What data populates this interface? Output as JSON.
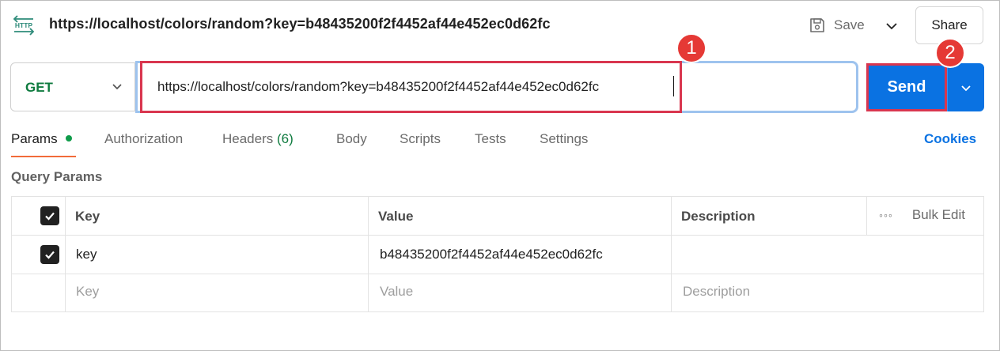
{
  "header": {
    "icon": "http-icon",
    "icon_text": "HTTP",
    "title": "https://localhost/colors/random?key=b48435200f2f4452af44e452ec0d62fc",
    "save_label": "Save",
    "share_label": "Share"
  },
  "request": {
    "method": "GET",
    "url": "https://localhost/colors/random?key=b48435200f2f4452af44e452ec0d62fc",
    "send_label": "Send"
  },
  "annotations": {
    "badge1": "1",
    "badge2": "2",
    "highlight_color": "#d9364f"
  },
  "tabs": [
    {
      "label": "Params",
      "active": true,
      "indicator": "green-dot"
    },
    {
      "label": "Authorization"
    },
    {
      "label": "Headers",
      "count": "(6)"
    },
    {
      "label": "Body"
    },
    {
      "label": "Scripts"
    },
    {
      "label": "Tests"
    },
    {
      "label": "Settings"
    }
  ],
  "cookies_label": "Cookies",
  "query_params": {
    "title": "Query Params",
    "columns": {
      "key": "Key",
      "value": "Value",
      "description": "Description"
    },
    "bulk_edit_label": "Bulk Edit",
    "rows": [
      {
        "checked": true,
        "key": "key",
        "value": "b48435200f2f4452af44e452ec0d62fc",
        "description": ""
      }
    ],
    "placeholder": {
      "key": "Key",
      "value": "Value",
      "description": "Description"
    }
  },
  "colors": {
    "accent_blue": "#0a72e2",
    "method_green": "#0f7b3f",
    "tab_underline": "#f26b3a",
    "badge_red": "#e53935"
  }
}
